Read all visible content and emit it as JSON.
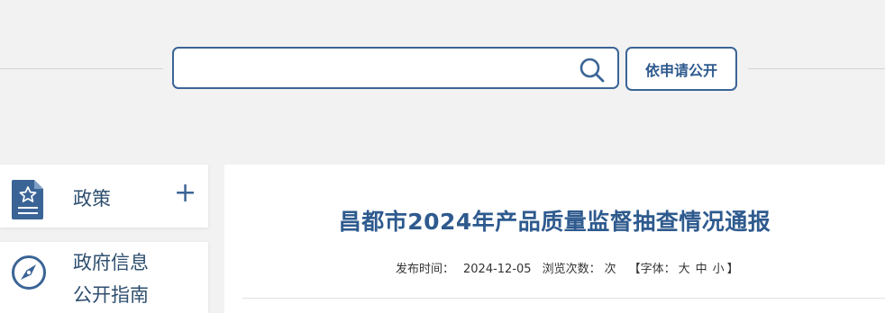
{
  "search": {
    "value": "",
    "placeholder": "",
    "apply_button_label": "依申请公开"
  },
  "sidebar": {
    "items": [
      {
        "label": "政策",
        "expand_symbol": "+"
      },
      {
        "label_line1": "政府信息",
        "label_line2": "公开指南"
      }
    ]
  },
  "article": {
    "title": "昌都市2024年产品质量监督抽查情况通报",
    "publish_label": "发布时间：",
    "publish_date": "2024-12-05",
    "views_label": "浏览次数：",
    "views_suffix": "次",
    "font_open": "【字体：",
    "font_large": "大",
    "font_medium": "中",
    "font_small": "小",
    "font_close": "】"
  },
  "colors": {
    "accent": "#3b6496",
    "title": "#2e5a8e",
    "background": "#f2f2f2"
  },
  "icons": {
    "search": "search-icon",
    "policy": "policy-document-star-icon",
    "guide": "compass-icon"
  }
}
